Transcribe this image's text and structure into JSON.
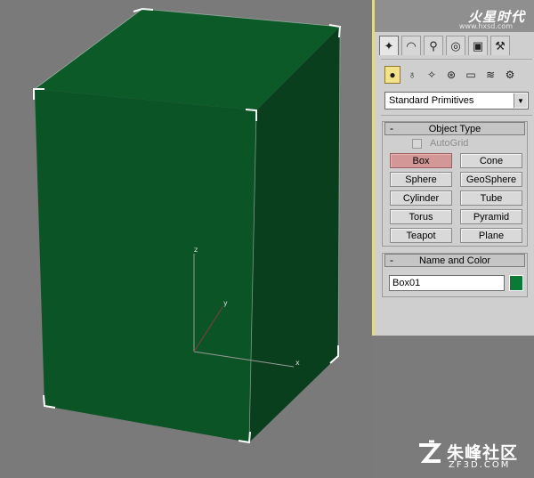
{
  "viewport": {
    "axis_labels": {
      "z": "z",
      "y": "y",
      "x": "x"
    },
    "box_color": "#0c5a26"
  },
  "header": {
    "logo_text": "火星时代",
    "logo_sub": "www.hxsd.com"
  },
  "command_panel": {
    "tabs": [
      {
        "icon": "create-icon"
      },
      {
        "icon": "modify-icon"
      },
      {
        "icon": "hierarchy-icon"
      },
      {
        "icon": "motion-icon"
      },
      {
        "icon": "display-icon"
      },
      {
        "icon": "utilities-icon"
      }
    ],
    "categories": [
      {
        "icon": "geometry-icon"
      },
      {
        "icon": "shapes-icon"
      },
      {
        "icon": "lights-icon"
      },
      {
        "icon": "cameras-icon"
      },
      {
        "icon": "helpers-icon"
      },
      {
        "icon": "spacewarps-icon"
      },
      {
        "icon": "systems-icon"
      }
    ],
    "dropdown_value": "Standard Primitives",
    "object_type": {
      "title": "Object Type",
      "collapse": "-",
      "autogrid_label": "AutoGrid",
      "buttons": [
        "Box",
        "Cone",
        "Sphere",
        "GeoSphere",
        "Cylinder",
        "Tube",
        "Torus",
        "Pyramid",
        "Teapot",
        "Plane"
      ],
      "selected": "Box"
    },
    "name_and_color": {
      "title": "Name and Color",
      "collapse": "-",
      "name_value": "Box01",
      "color": "#0a7a36"
    }
  },
  "watermark": {
    "cn": "朱峰社区",
    "en": "ZF3D.COM"
  }
}
